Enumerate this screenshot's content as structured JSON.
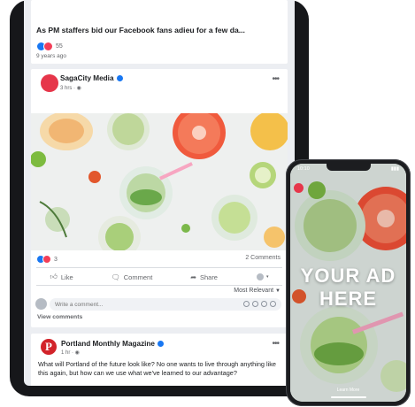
{
  "tablet": {
    "prev_post": {
      "headline": "As PM staffers bid our Facebook fans adieu for a few da...",
      "reaction_count": "55",
      "time_ago": "9 years ago"
    },
    "post": {
      "page_name": "SagaCity Media",
      "meta": "3 hrs · ",
      "more_icon": "more-dots-icon",
      "reaction_count": "3",
      "comments_count": "2 Comments",
      "actions": {
        "like": "Like",
        "comment": "Comment",
        "share": "Share"
      },
      "sort_label": "Most Relevant",
      "comment_placeholder": "Write a comment...",
      "view_comments": "View comments"
    },
    "next_post": {
      "page_name": "Portland Monthly Magazine",
      "logo_letter": "P",
      "meta": "1 hr · ",
      "text": "What will Portland of the future look like? No one wants to live through anything like this again, but how can we use what we've learned to our advantage?"
    }
  },
  "phone": {
    "time": "10:10",
    "ad_line1": "YOUR AD",
    "ad_line2": "HERE",
    "cta": "Learn More"
  },
  "colors": {
    "facebook_blue": "#1877f2",
    "avatar_red": "#e6364a",
    "portland_red": "#d2232a"
  }
}
